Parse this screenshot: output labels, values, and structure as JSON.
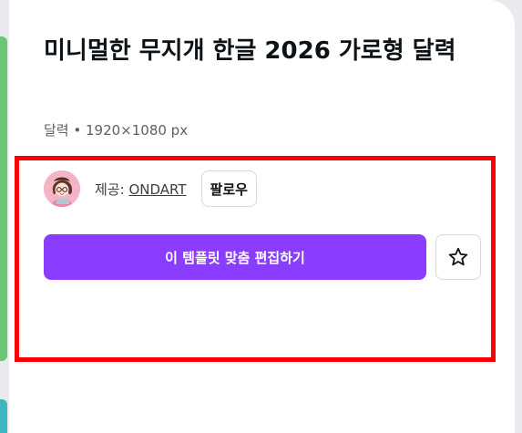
{
  "template": {
    "title": "미니멀한 무지개 한글 2026 가로형 달력",
    "meta": "달력 • 1920×1080 px"
  },
  "creator": {
    "provided_label": "제공: ",
    "name": "ONDART",
    "follow_label": "팔로우"
  },
  "actions": {
    "customize_label": "이 템플릿 맞춤 편집하기",
    "favorite_icon": "star-outline-icon"
  },
  "colors": {
    "accent": "#8b3dff",
    "highlight": "#ff0000",
    "side_card_green": "#6cc577",
    "side_card_teal": "#3cb7bd"
  }
}
